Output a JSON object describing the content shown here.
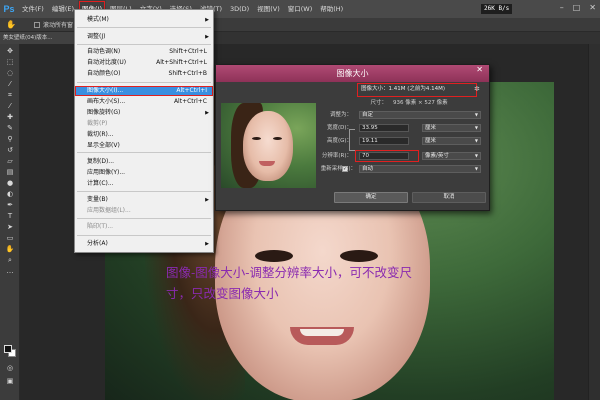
{
  "app": {
    "logo": "Ps",
    "speed": "26K B/s"
  },
  "menubar": {
    "items": [
      "文件(F)",
      "编辑(E)",
      "图像(I)",
      "图层(L)",
      "文字(Y)",
      "选择(S)",
      "滤镜(T)",
      "3D(D)",
      "视图(V)",
      "窗口(W)",
      "帮助(H)"
    ],
    "active_index": 2
  },
  "options_bar": {
    "checkbox_label": "滚动所有窗"
  },
  "document_tab": {
    "label": "美女壁纸(04)版本..."
  },
  "image_menu": {
    "items": [
      {
        "label": "模式(M)",
        "shortcut": "",
        "submenu": true,
        "dim": false
      },
      {
        "label": "调整(J)",
        "shortcut": "",
        "submenu": true,
        "dim": false
      },
      {
        "label": "自动色调(N)",
        "shortcut": "Shift+Ctrl+L",
        "submenu": false,
        "dim": false
      },
      {
        "label": "自动对比度(U)",
        "shortcut": "Alt+Shift+Ctrl+L",
        "submenu": false,
        "dim": false
      },
      {
        "label": "自动颜色(O)",
        "shortcut": "Shift+Ctrl+B",
        "submenu": false,
        "dim": false
      },
      {
        "label": "图像大小(I)...",
        "shortcut": "Alt+Ctrl+I",
        "submenu": false,
        "dim": false,
        "highlighted": true
      },
      {
        "label": "画布大小(S)...",
        "shortcut": "Alt+Ctrl+C",
        "submenu": false,
        "dim": false
      },
      {
        "label": "图像旋转(G)",
        "shortcut": "",
        "submenu": true,
        "dim": false
      },
      {
        "label": "裁剪(P)",
        "shortcut": "",
        "submenu": false,
        "dim": true
      },
      {
        "label": "裁切(R)...",
        "shortcut": "",
        "submenu": false,
        "dim": false
      },
      {
        "label": "显示全部(V)",
        "shortcut": "",
        "submenu": false,
        "dim": false
      },
      {
        "label": "复制(D)...",
        "shortcut": "",
        "submenu": false,
        "dim": false
      },
      {
        "label": "应用图像(Y)...",
        "shortcut": "",
        "submenu": false,
        "dim": false
      },
      {
        "label": "计算(C)...",
        "shortcut": "",
        "submenu": false,
        "dim": false
      },
      {
        "label": "变量(B)",
        "shortcut": "",
        "submenu": true,
        "dim": false
      },
      {
        "label": "应用数据组(L)...",
        "shortcut": "",
        "submenu": false,
        "dim": true
      },
      {
        "label": "陷印(T)...",
        "shortcut": "",
        "submenu": false,
        "dim": true
      },
      {
        "label": "分析(A)",
        "shortcut": "",
        "submenu": true,
        "dim": false
      }
    ]
  },
  "dialog": {
    "title": "图像大小",
    "image_size": "图像大小：1.41M (之前为4.14M)",
    "dimensions_label": "尺寸：",
    "dimensions_value": "936 像素 × 527 像素",
    "fit_to_label": "调整为：",
    "fit_to_value": "自定",
    "width_label": "宽度(D)：",
    "width_value": "33.95",
    "width_unit": "厘米",
    "height_label": "高度(G)：",
    "height_value": "19.11",
    "height_unit": "厘米",
    "resolution_label": "分辨率(R)：",
    "resolution_value": "70",
    "resolution_unit": "像素/英寸",
    "resample_label": "重新采样(S)：",
    "resample_checked": true,
    "resample_value": "自动",
    "ok_label": "确定",
    "cancel_label": "取消"
  },
  "annotation": {
    "text": "图像-图像大小-调整分辨率大小，可不改变尺寸，只改变图像大小"
  },
  "colors": {
    "menubar": "#4a4a4a",
    "dialog_title": "#9c3d66",
    "highlight": "#3a8fe0",
    "red_marker": "#e02020",
    "annotation": "#8a2ab0"
  }
}
